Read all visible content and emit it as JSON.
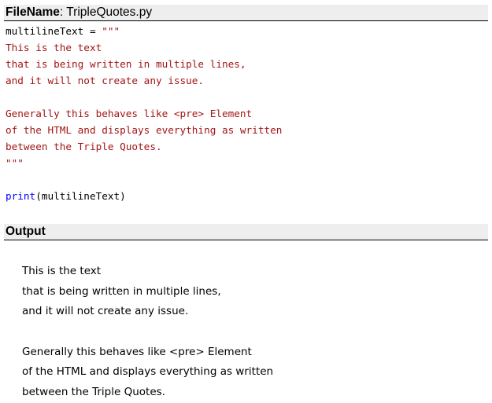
{
  "file_header": {
    "label": "FileName",
    "separator": ": ",
    "filename": "TripleQuotes.py"
  },
  "code": {
    "assign": "multilineText = ",
    "string_lines": [
      "\"\"\"",
      "This is the text",
      "that is being written in multiple lines,",
      "and it will not create any issue.",
      "",
      "Generally this behaves like <pre> Element",
      "of the HTML and displays everything as written",
      "between the Triple Quotes.",
      "\"\"\""
    ],
    "print_kw": "print",
    "print_args": "(multilineText)"
  },
  "output_header": {
    "label": "Output"
  },
  "output": {
    "lines": [
      "This is the text",
      "that is being written in multiple lines,",
      "and it will not create any issue.",
      "",
      "Generally this behaves like <pre> Element",
      "of the HTML and displays everything as written",
      "between the Triple Quotes."
    ]
  },
  "colors": {
    "header_bg": "#eeeeee",
    "string": "#a31515",
    "keyword": "#0000ff",
    "text": "#000000"
  }
}
